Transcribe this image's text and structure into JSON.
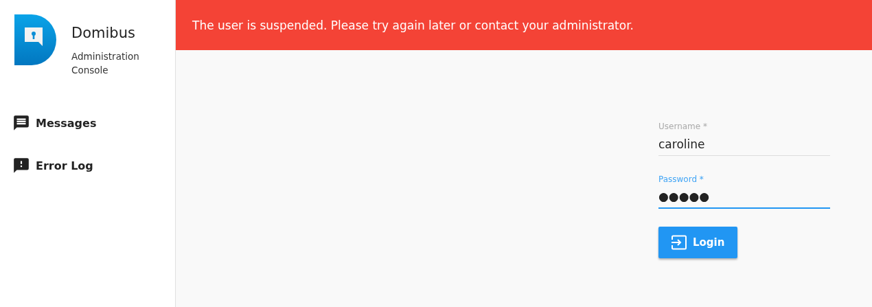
{
  "brand": {
    "title": "Domibus",
    "subtitle": "Administration Console"
  },
  "sidebar": {
    "items": [
      {
        "label": "Messages",
        "kind": "messages",
        "selected": false
      },
      {
        "label": "Error Log",
        "kind": "error",
        "selected": false
      }
    ]
  },
  "alert": {
    "text": "The user is suspended. Please try again later or contact your administrator."
  },
  "login_form": {
    "fields": [
      {
        "label": "Username *",
        "value": "caroline",
        "focused": false
      },
      {
        "label": "Password *",
        "value": "●●●●●",
        "focused": true
      }
    ],
    "button": "Login"
  }
}
